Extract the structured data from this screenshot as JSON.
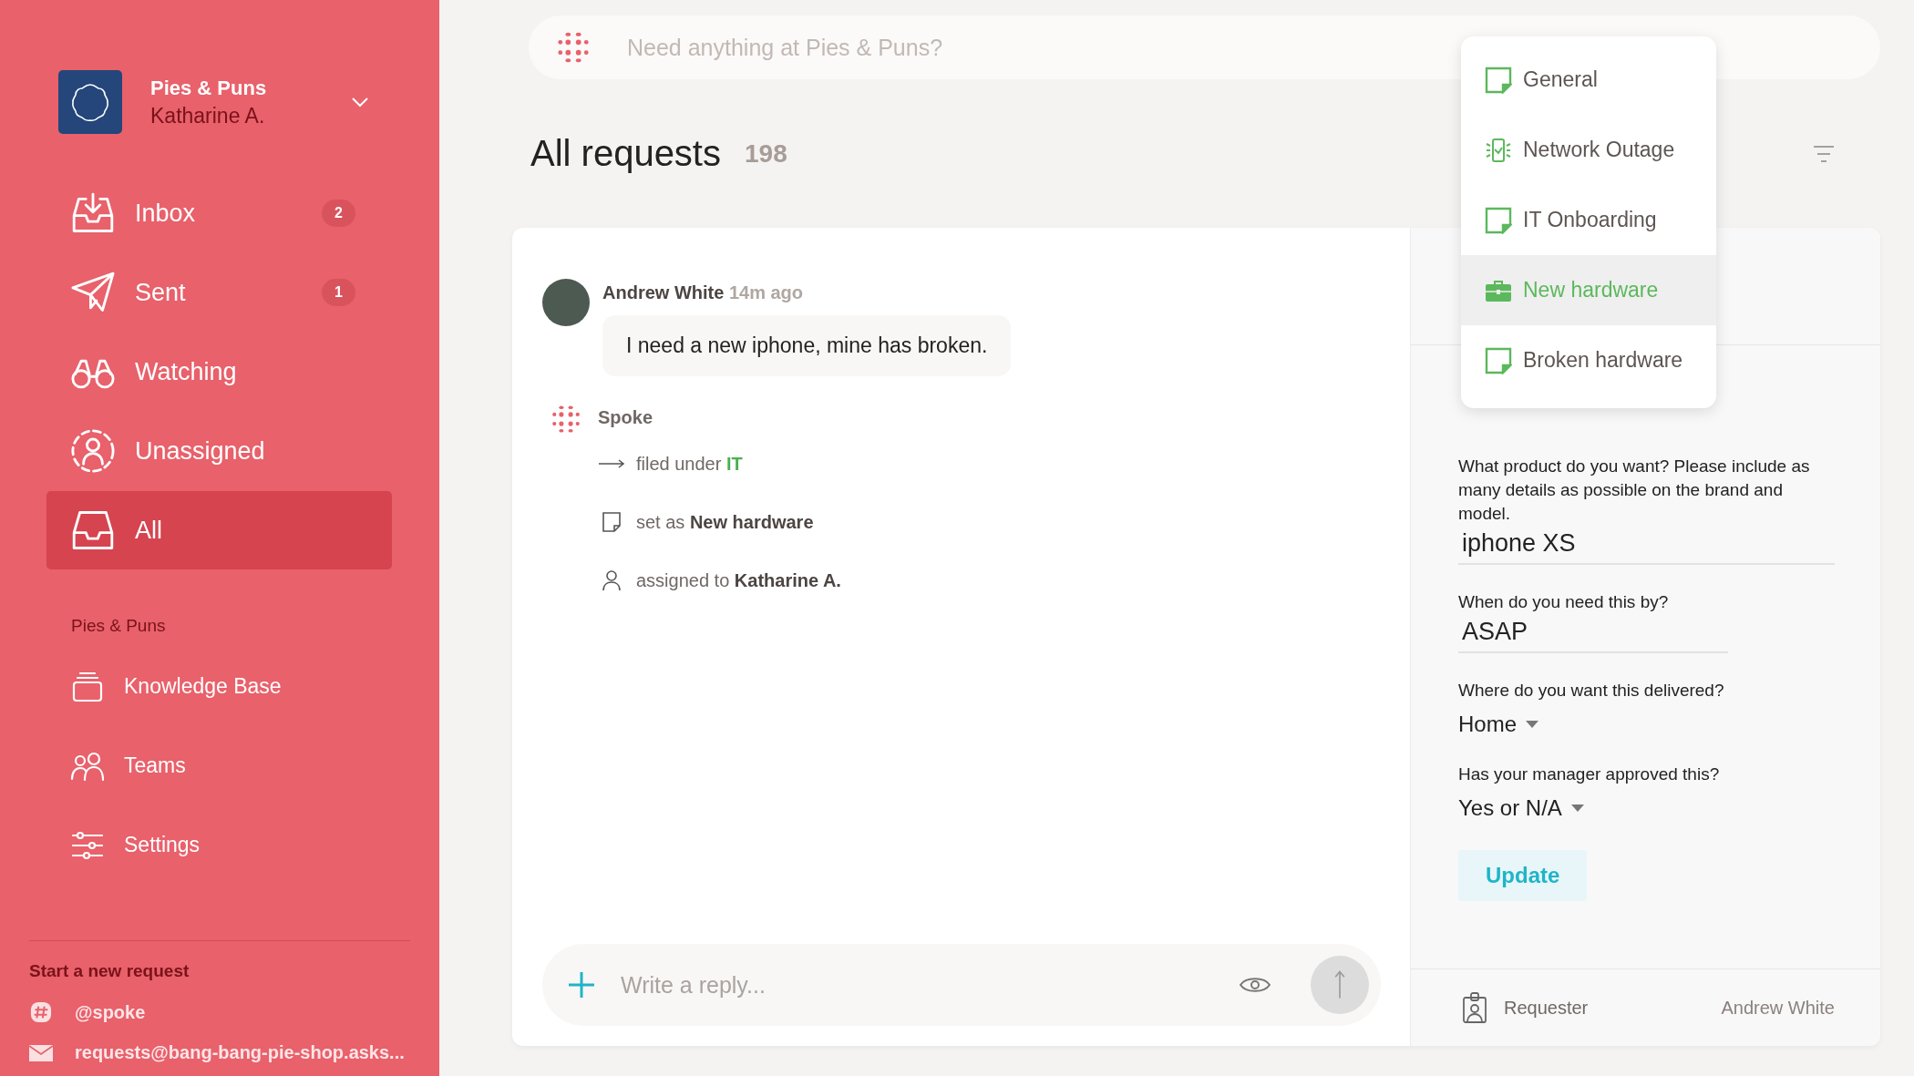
{
  "workspace": {
    "name": "Pies & Puns",
    "user": "Katharine A."
  },
  "nav": [
    {
      "label": "Inbox",
      "count": "2",
      "selected": false
    },
    {
      "label": "Sent",
      "count": "1",
      "selected": false
    },
    {
      "label": "Watching",
      "selected": false
    },
    {
      "label": "Unassigned",
      "selected": false
    },
    {
      "label": "All",
      "selected": true
    }
  ],
  "section": {
    "title": "Pies & Puns",
    "items": [
      {
        "label": "Knowledge Base"
      },
      {
        "label": "Teams"
      },
      {
        "label": "Settings"
      }
    ]
  },
  "new_request": {
    "title": "Start a new request",
    "channels": [
      {
        "kind": "slack",
        "label": "@spoke"
      },
      {
        "kind": "email",
        "label": "requests@bang-bang-pie-shop.asks..."
      }
    ]
  },
  "search": {
    "placeholder": "Need anything at Pies & Puns?"
  },
  "header": {
    "title": "All requests",
    "count": "198"
  },
  "message": {
    "author": "Andrew White",
    "time": "14m ago",
    "text": "I need a new iphone, mine has broken."
  },
  "bot": {
    "name": "Spoke",
    "events": [
      {
        "kind": "filed",
        "text": "filed under",
        "value": "IT"
      },
      {
        "kind": "type",
        "text": "set as",
        "value": "New hardware"
      },
      {
        "kind": "assigned",
        "text": "assigned to",
        "value": "Katharine A."
      }
    ]
  },
  "reply": {
    "placeholder": "Write a reply..."
  },
  "type_menu": [
    {
      "label": "General",
      "kind": "note",
      "selected": false
    },
    {
      "label": "Network Outage",
      "kind": "network",
      "selected": false
    },
    {
      "label": "IT Onboarding",
      "kind": "note",
      "selected": false
    },
    {
      "label": "New hardware",
      "kind": "briefcase",
      "selected": true
    },
    {
      "label": "Broken hardware",
      "kind": "note",
      "selected": false
    }
  ],
  "form": {
    "fields": [
      {
        "kind": "text",
        "label": "What product do you want? Please include as many details as possible on the brand and model.",
        "value": "iphone XS"
      },
      {
        "kind": "text",
        "label": "When do you need this by?",
        "value": "ASAP"
      },
      {
        "kind": "select",
        "label": "Where do you want this delivered?",
        "value": "Home"
      },
      {
        "kind": "select",
        "label": "Has your manager approved this?",
        "value": "Yes or N/A"
      }
    ],
    "button": "Update"
  },
  "requester": {
    "label": "Requester",
    "value": "Andrew White"
  }
}
